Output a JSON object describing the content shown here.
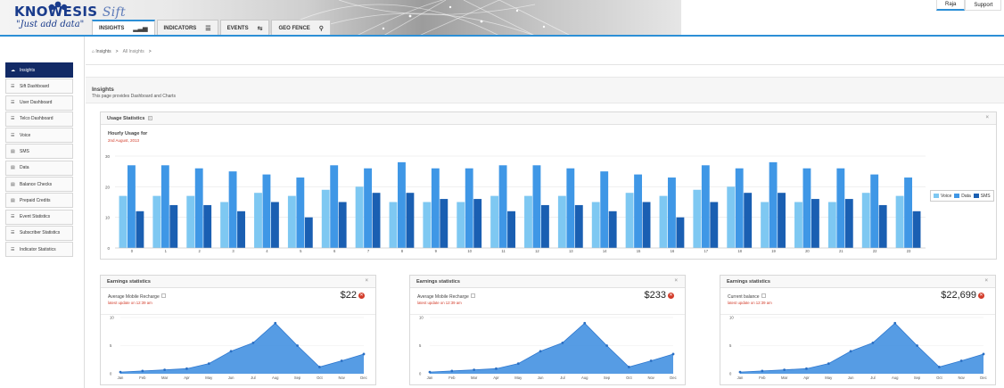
{
  "header": {
    "brand": "KNOWESIS",
    "brand_suffix": "Sift",
    "tagline": "\"Just add data\"",
    "accent": "#2c8fd6"
  },
  "nav": {
    "tabs": [
      {
        "label": "INSIGHTS",
        "icon": "bar-chart-icon",
        "active": true
      },
      {
        "label": "INDICATORS",
        "icon": "list-icon",
        "active": false
      },
      {
        "label": "EVENTS",
        "icon": "retweet-icon",
        "active": false
      },
      {
        "label": "GEO FENCE",
        "icon": "map-marker-icon",
        "active": false
      }
    ]
  },
  "top_links": [
    {
      "label": "Raja",
      "active": true
    },
    {
      "label": "Support",
      "active": false
    }
  ],
  "sidebar": {
    "items": [
      {
        "label": "Insights",
        "icon": "cloud-icon",
        "active": true
      },
      {
        "label": "Sift Dashboard",
        "icon": "list-icon",
        "active": false
      },
      {
        "label": "User Dashboard",
        "icon": "list-icon",
        "active": false
      },
      {
        "label": "Telco Dashboard",
        "icon": "list-icon",
        "active": false
      },
      {
        "label": "Voice",
        "icon": "list-icon",
        "active": false
      },
      {
        "label": "SMS",
        "icon": "table-icon",
        "active": false
      },
      {
        "label": "Data",
        "icon": "table-icon",
        "active": false
      },
      {
        "label": "Balance Checks",
        "icon": "table-icon",
        "active": false
      },
      {
        "label": "Prepaid Credits",
        "icon": "table-icon",
        "active": false
      },
      {
        "label": "Event Statistics",
        "icon": "list-icon",
        "active": false
      },
      {
        "label": "Subscriber Statistics",
        "icon": "list-icon",
        "active": false
      },
      {
        "label": "Indicator Statistics",
        "icon": "list-icon",
        "active": false
      }
    ]
  },
  "breadcrumb": {
    "home": "Insights",
    "sep": ">",
    "current": "All Insights"
  },
  "page": {
    "title": "Insights",
    "subtitle": "This page provides Dashboard and Charts"
  },
  "usage_panel": {
    "title": "Usage Statistics",
    "chart_title": "Hourly Usage for",
    "chart_date": "2nd August, 2013"
  },
  "earnings": [
    {
      "title": "Earnings statistics",
      "metric": "Average Mobile Recharge",
      "update": "latest update on 12:39 am",
      "value": "$22"
    },
    {
      "title": "Earnings statistics",
      "metric": "Average Mobile Recharge",
      "update": "latest update on 12:39 am",
      "value": "$233"
    },
    {
      "title": "Earnings statistics",
      "metric": "Current balance",
      "update": "latest update on 12:39 am",
      "value": "$22,699"
    }
  ],
  "chart_data": [
    {
      "type": "bar",
      "title": "Hourly Usage for",
      "categories": [
        "0",
        "1",
        "2",
        "3",
        "4",
        "5",
        "6",
        "7",
        "8",
        "9",
        "10",
        "11",
        "12",
        "13",
        "14",
        "15",
        "16",
        "17",
        "18",
        "19",
        "20",
        "21",
        "22",
        "23"
      ],
      "series": [
        {
          "name": "Voice",
          "color": "#7ec8f2",
          "values": [
            17,
            17,
            17,
            15,
            18,
            17,
            19,
            20,
            15,
            15,
            15,
            17,
            17,
            17,
            15,
            18,
            17,
            19,
            20,
            15,
            15,
            15,
            18,
            17
          ]
        },
        {
          "name": "Data",
          "color": "#3f97e6",
          "values": [
            27,
            27,
            26,
            25,
            24,
            23,
            27,
            26,
            28,
            26,
            26,
            27,
            27,
            26,
            25,
            24,
            23,
            27,
            26,
            28,
            26,
            26,
            24,
            23
          ]
        },
        {
          "name": "SMS",
          "color": "#1a5fb2",
          "values": [
            12,
            14,
            14,
            12,
            15,
            10,
            15,
            18,
            18,
            16,
            16,
            12,
            14,
            14,
            12,
            15,
            10,
            15,
            18,
            18,
            16,
            16,
            14,
            12
          ]
        }
      ],
      "yticks": [
        0,
        10,
        20,
        30
      ],
      "ylim": [
        0,
        30
      ],
      "grid": true,
      "legend": "right"
    },
    {
      "type": "area",
      "categories": [
        "Jan",
        "Feb",
        "Mar",
        "Apr",
        "May",
        "Jun",
        "Jul",
        "Aug",
        "Sep",
        "Oct",
        "Nov",
        "Dec"
      ],
      "series": [
        {
          "values": [
            0.3,
            0.5,
            0.7,
            0.9,
            1.8,
            4.0,
            5.5,
            9.0,
            5.0,
            1.2,
            2.3,
            3.5
          ]
        }
      ],
      "yticks": [
        0,
        5,
        10
      ],
      "ylim": [
        0,
        10
      ],
      "color": "#3f8ee0"
    },
    {
      "type": "area",
      "categories": [
        "Jan",
        "Feb",
        "Mar",
        "Apr",
        "May",
        "Jun",
        "Jul",
        "Aug",
        "Sep",
        "Oct",
        "Nov",
        "Dec"
      ],
      "series": [
        {
          "values": [
            0.3,
            0.5,
            0.7,
            0.9,
            1.8,
            4.0,
            5.5,
            9.0,
            5.0,
            1.2,
            2.3,
            3.5
          ]
        }
      ],
      "yticks": [
        0,
        5,
        10
      ],
      "ylim": [
        0,
        10
      ],
      "color": "#3f8ee0"
    },
    {
      "type": "area",
      "categories": [
        "Jan",
        "Feb",
        "Mar",
        "Apr",
        "May",
        "Jun",
        "Jul",
        "Aug",
        "Sep",
        "Oct",
        "Nov",
        "Dec"
      ],
      "series": [
        {
          "values": [
            0.3,
            0.5,
            0.7,
            0.9,
            1.8,
            4.0,
            5.5,
            9.0,
            5.0,
            1.2,
            2.3,
            3.5
          ]
        }
      ],
      "yticks": [
        0,
        5,
        10
      ],
      "ylim": [
        0,
        10
      ],
      "color": "#3f8ee0"
    }
  ]
}
